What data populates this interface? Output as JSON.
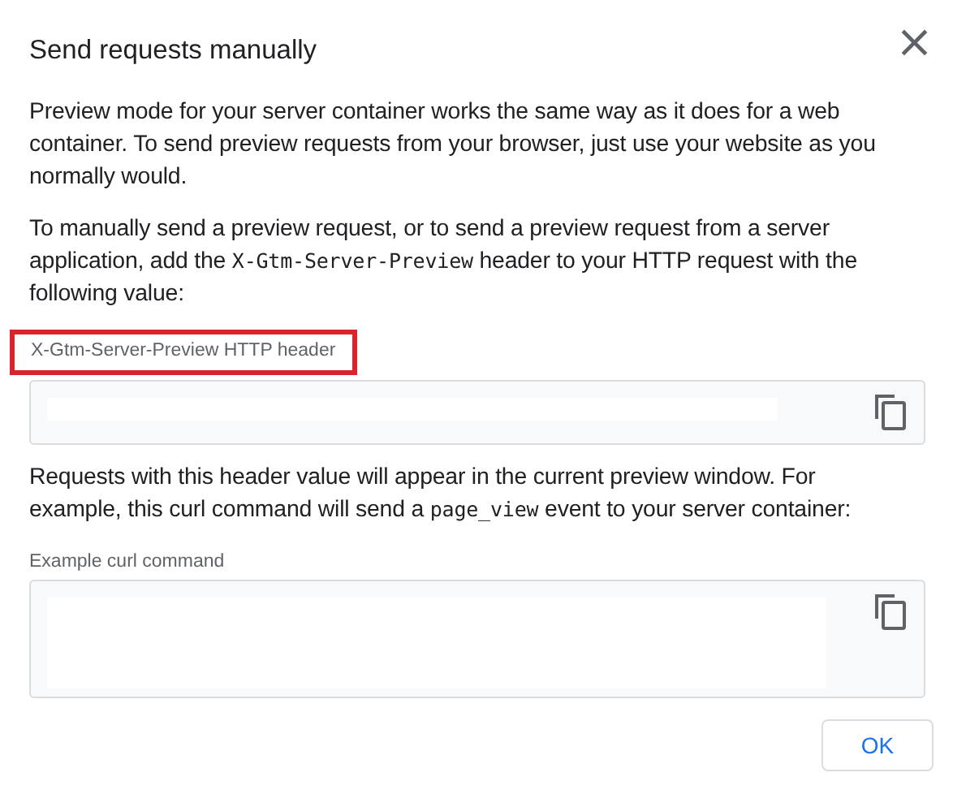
{
  "dialog": {
    "title": "Send requests manually",
    "close_icon": "×"
  },
  "intro": "Preview mode for your server container works the same way as it does for a web container. To send preview requests from your browser, just use your website as you normally would.",
  "instruction": [
    {
      "kind": "text",
      "text": "To manually send a preview request, or to send a preview request from a server application, add the "
    },
    {
      "kind": "code",
      "text": "X-Gtm-Server-Preview"
    },
    {
      "kind": "text",
      "text": " header to your HTTP request with the following value:"
    }
  ],
  "header_field": {
    "label": "X-Gtm-Server-Preview HTTP header",
    "highlighted": true
  },
  "note": [
    {
      "kind": "text",
      "text": "Requests with this header value will appear in the current preview window. For example, this curl command will send a "
    },
    {
      "kind": "code",
      "text": "page_view"
    },
    {
      "kind": "text",
      "text": " event to your server container:"
    }
  ],
  "curl_field": {
    "label": "Example curl command",
    "highlighted": false
  },
  "buttons": [
    "OK"
  ]
}
